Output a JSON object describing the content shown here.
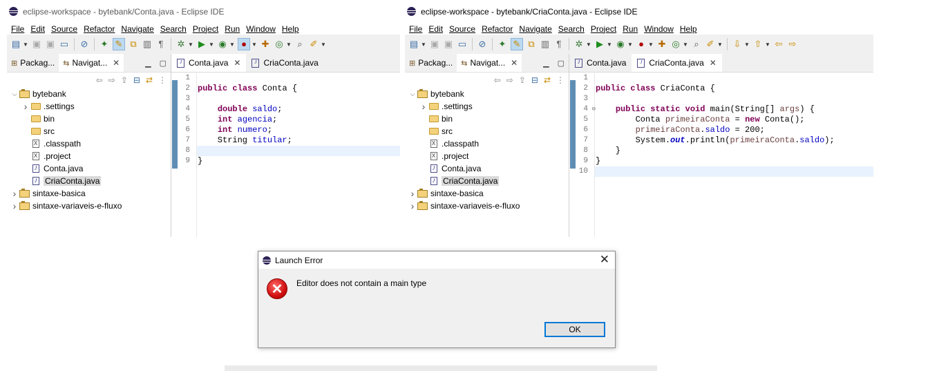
{
  "windows": [
    {
      "title": "eclipse-workspace - bytebank/Conta.java - Eclipse IDE",
      "menu": [
        "File",
        "Edit",
        "Source",
        "Refactor",
        "Navigate",
        "Search",
        "Project",
        "Run",
        "Window",
        "Help"
      ],
      "view_tabs": [
        "Packag...",
        "Navigat..."
      ],
      "editor_tabs": [
        "Conta.java",
        "CriaConta.java"
      ],
      "active_editor_tab": 0,
      "tree": [
        {
          "label": "bytebank",
          "type": "project",
          "expanded": true,
          "level": 0
        },
        {
          "label": ".settings",
          "type": "folder",
          "expandable": true,
          "level": 1
        },
        {
          "label": "bin",
          "type": "folder",
          "level": 1
        },
        {
          "label": "src",
          "type": "folder",
          "level": 1
        },
        {
          "label": ".classpath",
          "type": "xml",
          "level": 1
        },
        {
          "label": ".project",
          "type": "xml",
          "level": 1
        },
        {
          "label": "Conta.java",
          "type": "java",
          "level": 1
        },
        {
          "label": "CriaConta.java",
          "type": "java",
          "level": 1,
          "selected": true
        },
        {
          "label": "sintaxe-basica",
          "type": "project",
          "expandable": true,
          "level": 0
        },
        {
          "label": "sintaxe-variaveis-e-fluxo",
          "type": "project",
          "expandable": true,
          "level": 0
        }
      ],
      "line_numbers": [
        "1",
        "2",
        "3",
        "4",
        "5",
        "6",
        "7",
        "8",
        "9"
      ],
      "code": [
        "",
        "public class Conta {",
        "",
        "    double saldo;",
        "    int agencia;",
        "    int numero;",
        "    String titular;",
        "",
        "}"
      ],
      "current_line": 8
    },
    {
      "title": "eclipse-workspace - bytebank/CriaConta.java - Eclipse IDE",
      "menu": [
        "File",
        "Edit",
        "Source",
        "Refactor",
        "Navigate",
        "Search",
        "Project",
        "Run",
        "Window",
        "Help"
      ],
      "view_tabs": [
        "Packag...",
        "Navigat..."
      ],
      "editor_tabs": [
        "Conta.java",
        "CriaConta.java"
      ],
      "active_editor_tab": 1,
      "tree": [
        {
          "label": "bytebank",
          "type": "project",
          "expanded": true,
          "level": 0
        },
        {
          "label": ".settings",
          "type": "folder",
          "expandable": true,
          "level": 1
        },
        {
          "label": "bin",
          "type": "folder",
          "level": 1
        },
        {
          "label": "src",
          "type": "folder",
          "level": 1
        },
        {
          "label": ".classpath",
          "type": "xml",
          "level": 1
        },
        {
          "label": ".project",
          "type": "xml",
          "level": 1
        },
        {
          "label": "Conta.java",
          "type": "java",
          "level": 1
        },
        {
          "label": "CriaConta.java",
          "type": "java",
          "level": 1,
          "selected": true
        },
        {
          "label": "sintaxe-basica",
          "type": "project",
          "expandable": true,
          "level": 0
        },
        {
          "label": "sintaxe-variaveis-e-fluxo",
          "type": "project",
          "expandable": true,
          "level": 0
        }
      ],
      "line_numbers": [
        "1",
        "2",
        "3",
        "4",
        "5",
        "6",
        "7",
        "8",
        "9",
        "10"
      ],
      "code": [
        "",
        "public class CriaConta {",
        "",
        "    public static void main(String[] args) {",
        "        Conta primeiraConta = new Conta();",
        "        primeiraConta.saldo = 200;",
        "        System.out.println(primeiraConta.saldo);",
        "    }",
        "}",
        ""
      ],
      "current_line": 10
    }
  ],
  "dialog": {
    "title": "Launch Error",
    "message": "Editor does not contain a main type",
    "ok_label": "OK"
  },
  "icons": {
    "error": "error-icon",
    "close": "close-icon",
    "eclipse": "eclipse-logo-icon"
  }
}
